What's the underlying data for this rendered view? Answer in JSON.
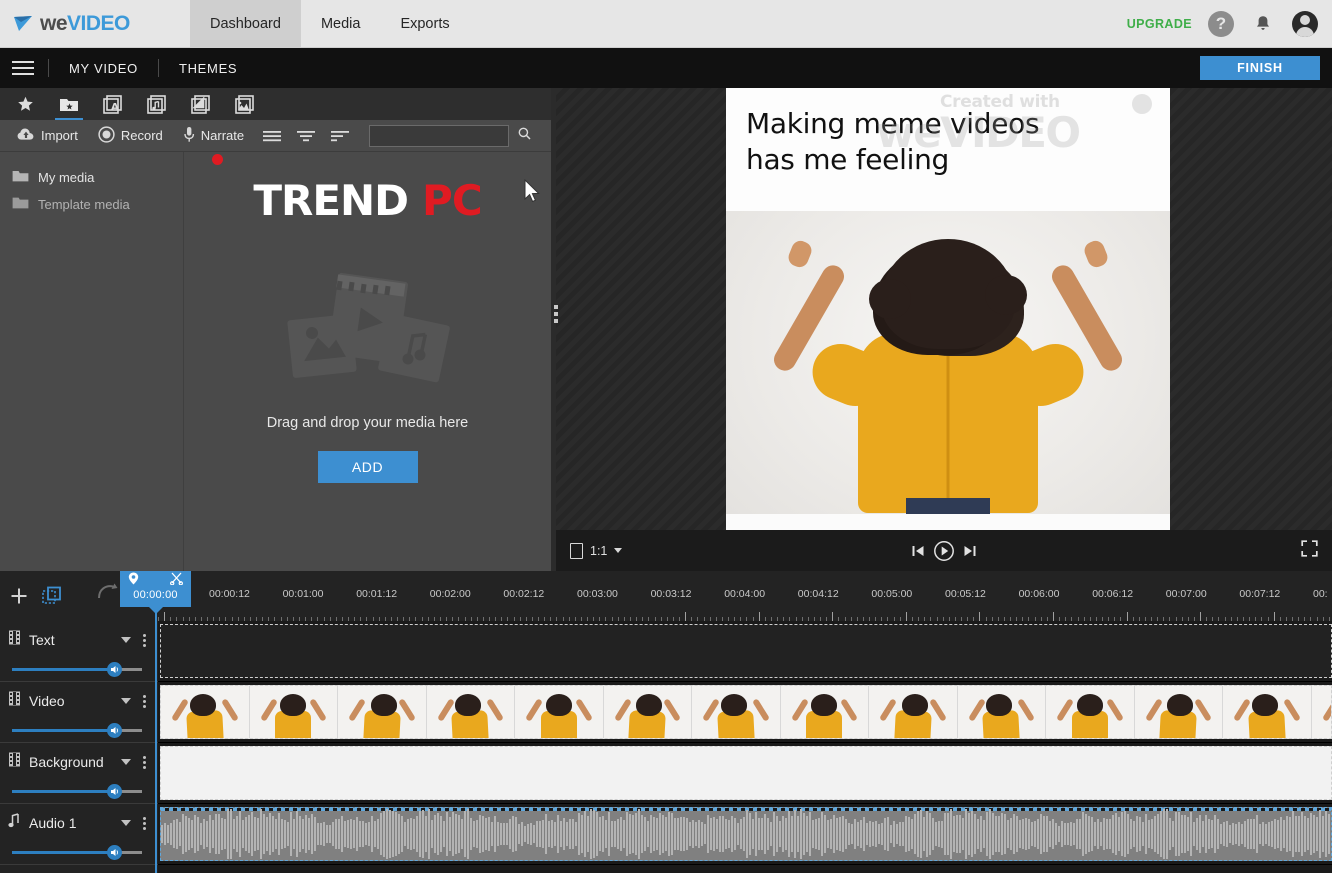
{
  "topnav": {
    "brand": {
      "we": "we",
      "video": "VIDEO"
    },
    "tabs": [
      {
        "label": "Dashboard",
        "active": true
      },
      {
        "label": "Media",
        "active": false
      },
      {
        "label": "Exports",
        "active": false
      }
    ],
    "upgrade_label": "UPGRADE",
    "help_glyph": "?",
    "bell_glyph": "\u0000"
  },
  "subbar": {
    "project_label": "MY VIDEO",
    "themes_label": "THEMES",
    "finish_label": "FINISH"
  },
  "media_panel": {
    "tabs": [
      {
        "name": "favorites-tab",
        "active": false
      },
      {
        "name": "my-media-tab",
        "active": true
      },
      {
        "name": "text-tab",
        "active": false
      },
      {
        "name": "audio-tab",
        "active": false
      },
      {
        "name": "transitions-tab",
        "active": false
      },
      {
        "name": "graphics-tab",
        "active": false
      }
    ],
    "actions": {
      "import_label": "Import",
      "record_label": "Record",
      "narrate_label": "Narrate"
    },
    "search_placeholder": "",
    "search_value": "",
    "tree": [
      {
        "label": "My media"
      },
      {
        "label": "Template media"
      }
    ],
    "watermark": {
      "trend": "TREND",
      "pc": "PC"
    },
    "drop_text": "Drag and drop your media here",
    "add_label": "ADD"
  },
  "preview": {
    "meme_line1": "Making meme videos",
    "meme_line2": "has me feeling",
    "watermark_created": "Created with",
    "watermark_logo": "weVIDEO",
    "aspect_ratio": "1:1"
  },
  "timeline": {
    "playhead": {
      "time": "00:00:00"
    },
    "ruler_labels": [
      "00:00:12",
      "00:01:00",
      "00:01:12",
      "00:02:00",
      "00:02:12",
      "00:03:00",
      "00:03:12",
      "00:04:00",
      "00:04:12",
      "00:05:00",
      "00:05:12",
      "00:06:00",
      "00:06:12",
      "00:07:00",
      "00:07:12",
      "00:"
    ],
    "tracks": [
      {
        "label": "Text",
        "icon": "film-icon",
        "volume": 80
      },
      {
        "label": "Video",
        "icon": "film-icon",
        "volume": 80
      },
      {
        "label": "Background",
        "icon": "film-icon",
        "volume": 80
      },
      {
        "label": "Audio 1",
        "icon": "music-note-icon",
        "volume": 80
      }
    ]
  },
  "colors": {
    "accent": "#3d8fd1",
    "upgrade_green": "#3fae49",
    "brand_blue": "#3d9ad9",
    "trend_red": "#e01b22",
    "panel_gray": "#4a4a4a",
    "timeline_bg": "#232323"
  }
}
